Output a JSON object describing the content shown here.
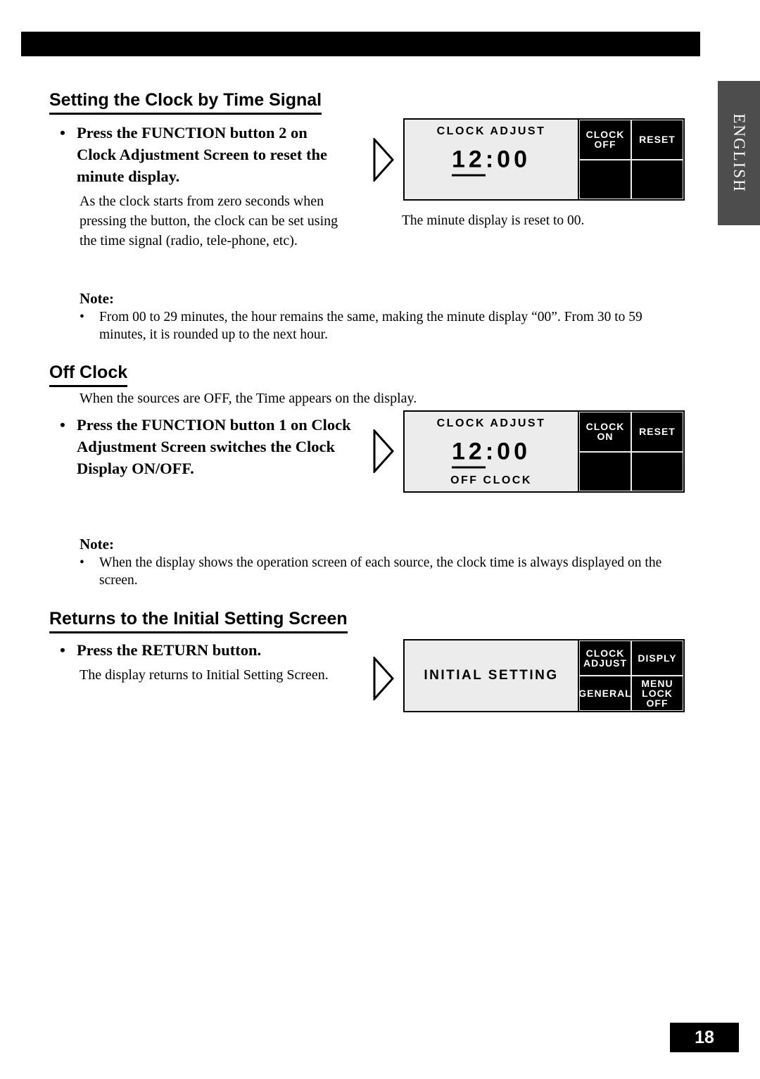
{
  "top_bar": true,
  "side_tab": {
    "label": "ENGLISH"
  },
  "page_number": "18",
  "sections": [
    {
      "title": "Setting the Clock by Time Signal",
      "bullet": "Press the FUNCTION button 2 on Clock Adjustment Screen to reset the minute display.",
      "body": "As the clock starts from zero seconds when pressing the button, the clock can be set using the time signal (radio, tele-phone, etc).",
      "caption": "The minute display is reset to 00.",
      "note_label": "Note:",
      "note_text": "From 00 to 29 minutes, the hour remains the same, making the minute display “00”. From 30 to 59 minutes, it is rounded up to the next hour.",
      "display": {
        "title": "CLOCK ADJUST",
        "clock_hour": "12",
        "clock_sep": ":",
        "clock_min": "00",
        "bottom": "",
        "cells": [
          {
            "line1": "CLOCK",
            "line2": "OFF"
          },
          {
            "line1": "RESET",
            "line2": ""
          },
          {
            "line1": "",
            "line2": ""
          },
          {
            "line1": "",
            "line2": ""
          }
        ]
      }
    },
    {
      "title": "Off Clock",
      "intro": "When the sources are OFF, the Time appears on the display.",
      "bullet": "Press the FUNCTION button 1 on Clock Adjustment Screen switches the Clock Display ON/OFF.",
      "note_label": "Note:",
      "note_text": "When the display shows the operation screen of each source, the clock time is always displayed on the screen.",
      "display": {
        "title": "CLOCK ADJUST",
        "clock_hour": "12",
        "clock_sep": ":",
        "clock_min": "00",
        "bottom": "OFF CLOCK",
        "cells": [
          {
            "line1": "CLOCK",
            "line2": "ON"
          },
          {
            "line1": "RESET",
            "line2": ""
          },
          {
            "line1": "",
            "line2": ""
          },
          {
            "line1": "",
            "line2": ""
          }
        ]
      }
    },
    {
      "title": "Returns to the Initial Setting Screen",
      "bullet": "Press the RETURN button.",
      "body": "The display returns to Initial Setting Screen.",
      "display": {
        "center_text": "INITIAL SETTING",
        "cells": [
          {
            "line1": "CLOCK",
            "line2": "ADJUST"
          },
          {
            "line1": "DISPLY",
            "line2": ""
          },
          {
            "line1": "GENERAL",
            "line2": ""
          },
          {
            "line1": "MENU LOCK",
            "line2": "OFF"
          }
        ]
      }
    }
  ]
}
